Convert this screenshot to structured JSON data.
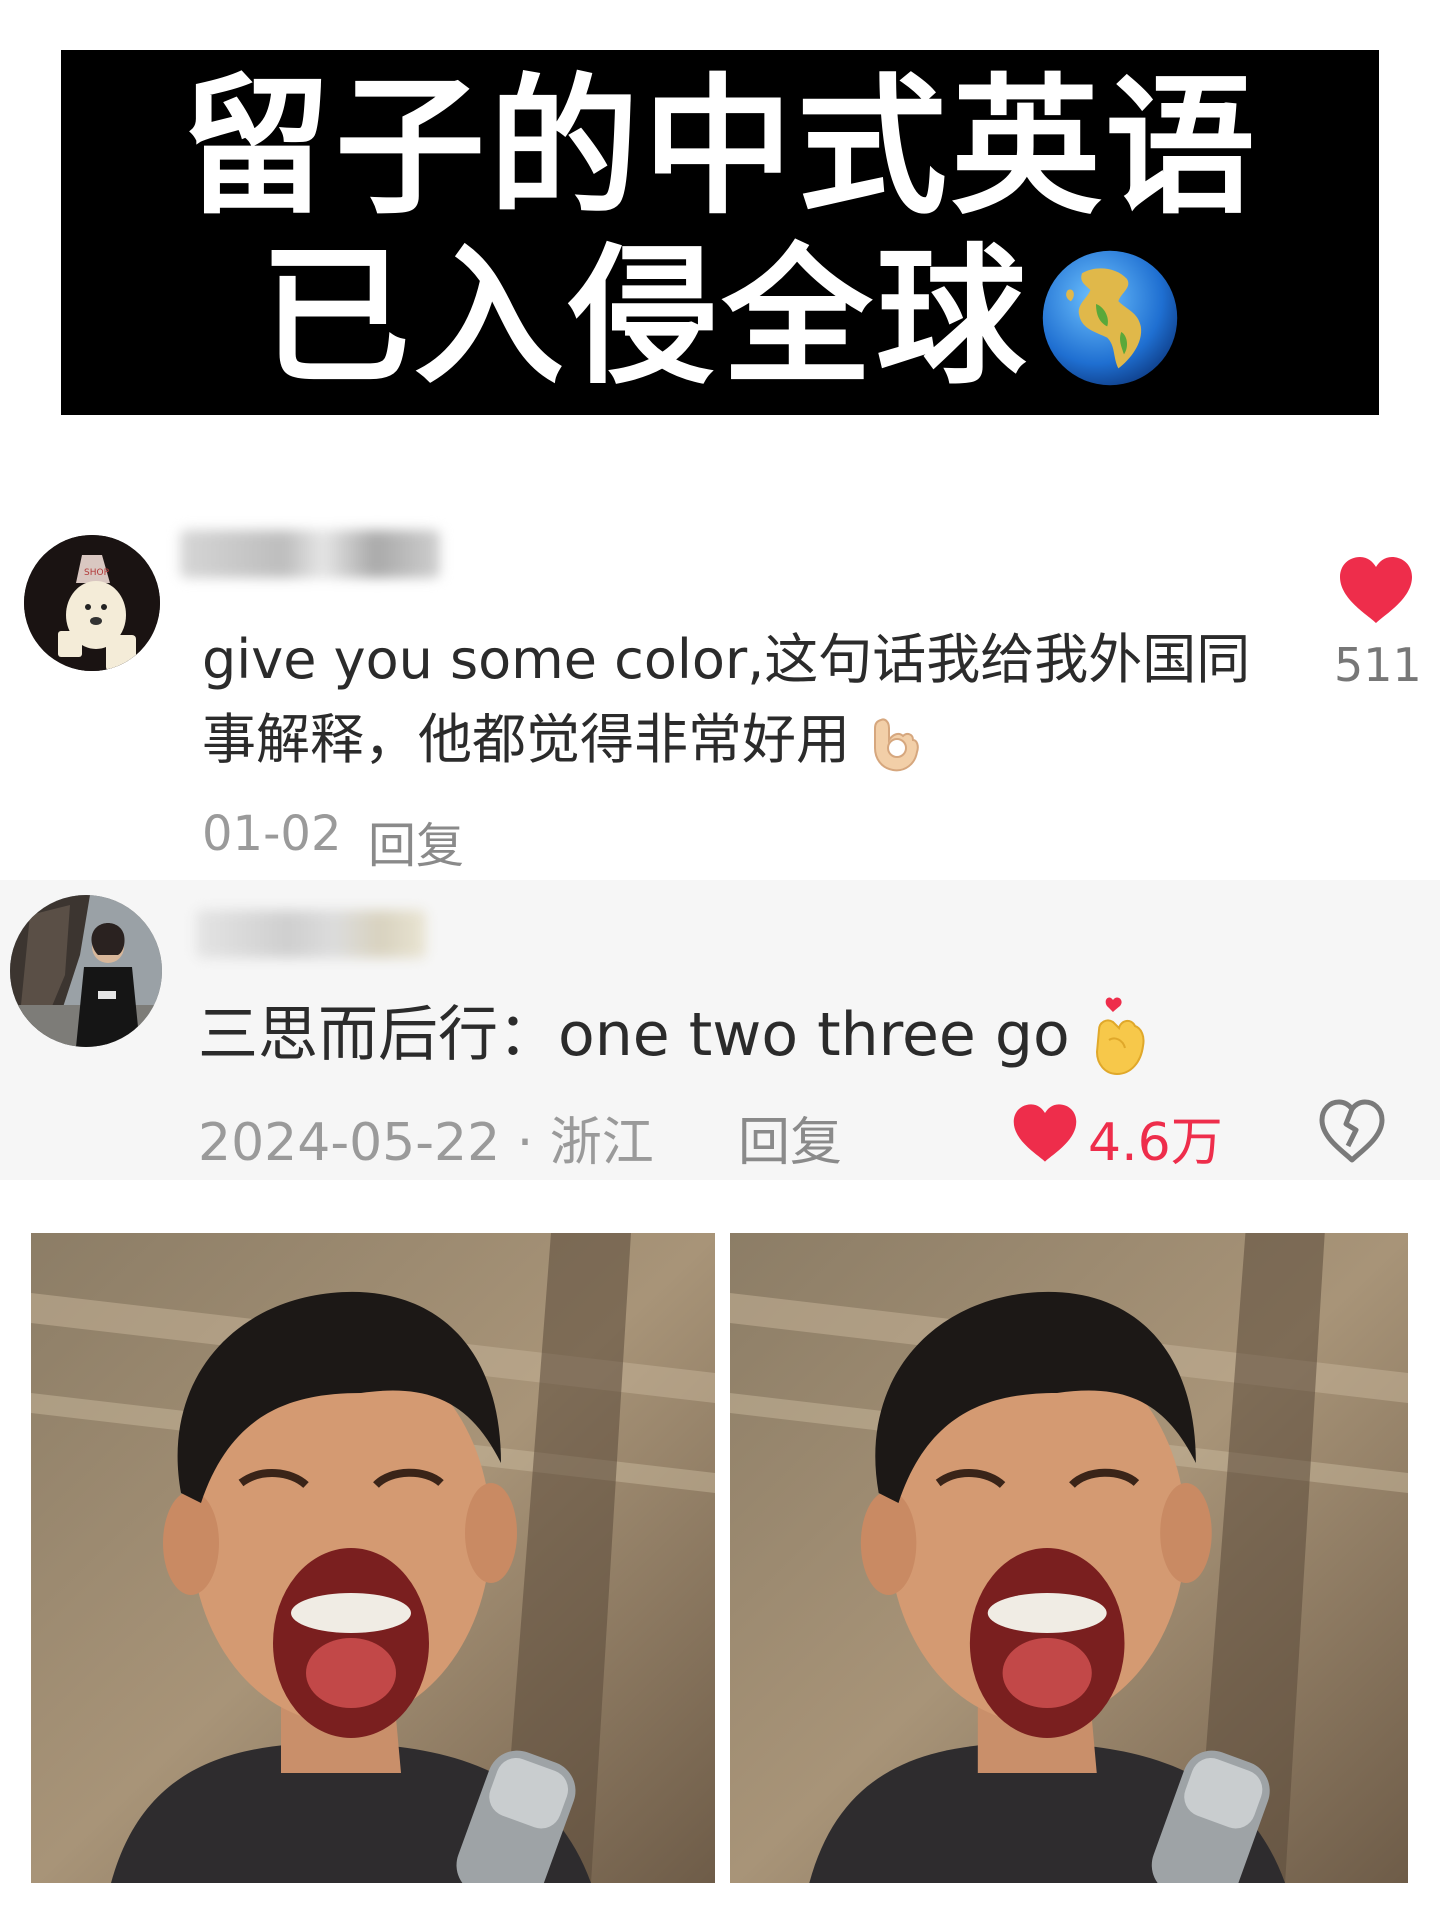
{
  "title": {
    "line1": "留子的中式英语",
    "line2": "已入侵全球",
    "emoji": "globe-europe-africa-icon"
  },
  "comments": [
    {
      "avatar": "avatar-cartoon-dog",
      "text": "give you some color,这句话我给我外国同事解释，他都觉得非常好用",
      "emoji": "ok-hand-icon",
      "date": "01-02",
      "reply_label": "回复",
      "likes": "511"
    },
    {
      "avatar": "avatar-person",
      "text": "三思而后行：one two three go",
      "emoji": "hand-heart-icon",
      "date": "2024-05-22 · 浙江",
      "reply_label": "回复",
      "likes": "4.6万"
    }
  ],
  "colors": {
    "banner_bg": "#000000",
    "like_red": "#ee2d4b",
    "meta_gray": "#9a9a9a"
  }
}
